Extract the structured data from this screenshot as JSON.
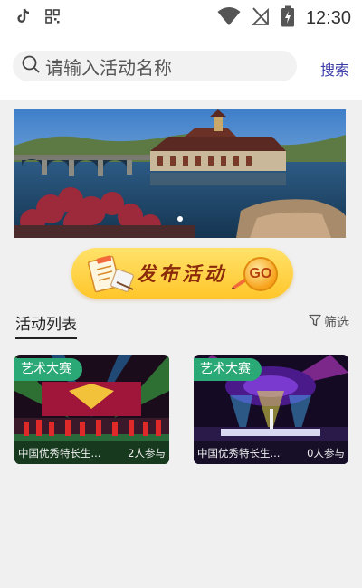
{
  "status_bar": {
    "time": "12:30",
    "left_icons": [
      "tiktok-icon",
      "qr-grid-icon"
    ],
    "right_icons": [
      "wifi-icon",
      "no-signal-icon",
      "battery-charging-icon"
    ]
  },
  "search": {
    "placeholder": "请输入活动名称",
    "button_label": "搜索"
  },
  "banner": {
    "slide_count_indicator": 1
  },
  "publish": {
    "label": "发布活动",
    "go_label": "GO"
  },
  "activity_list": {
    "title": "活动列表",
    "filter_label": "筛选",
    "items": [
      {
        "tag": "艺术大赛",
        "name": "中国优秀特长生...",
        "participants": "2人参与"
      },
      {
        "tag": "艺术大赛",
        "name": "中国优秀特长生...",
        "participants": "0人参与"
      }
    ]
  },
  "colors": {
    "accent": "#3a3aa8",
    "tag_green": "#2aa876",
    "publish_yellow": "#ffc62b"
  }
}
